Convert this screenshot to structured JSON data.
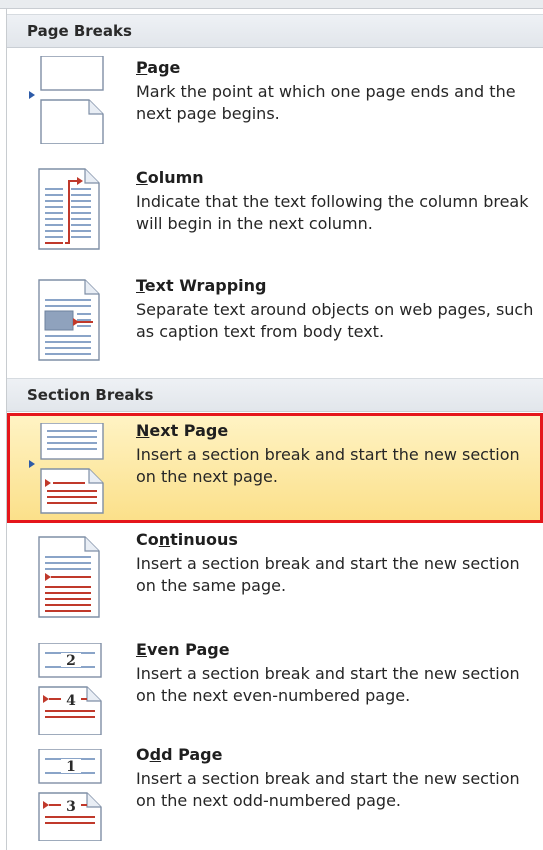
{
  "menu": {
    "page_breaks_header": "Page Breaks",
    "section_breaks_header": "Section Breaks",
    "items": [
      {
        "title_pre": "",
        "title_key": "P",
        "title_post": "age",
        "description": "Mark the point at which one page ends and the next page begins.",
        "icon": "page-break-icon"
      },
      {
        "title_pre": "",
        "title_key": "C",
        "title_post": "olumn",
        "description": "Indicate that the text following the column break will begin in the next column.",
        "icon": "column-break-icon"
      },
      {
        "title_pre": "",
        "title_key": "T",
        "title_post": "ext Wrapping",
        "description": "Separate text around objects on web pages, such as caption text from body text.",
        "icon": "text-wrapping-icon"
      },
      {
        "title_pre": "",
        "title_key": "N",
        "title_post": "ext Page",
        "description": "Insert a section break and start the new section on the next page.",
        "icon": "next-page-section-icon",
        "selected": true
      },
      {
        "title_pre": "Co",
        "title_key": "n",
        "title_post": "tinuous",
        "description": "Insert a section break and start the new section on the same page.",
        "icon": "continuous-section-icon"
      },
      {
        "title_pre": "",
        "title_key": "E",
        "title_post": "ven Page",
        "description": "Insert a section break and start the new section on the next even-numbered page.",
        "icon": "even-page-section-icon",
        "page_numbers": [
          "2",
          "4"
        ]
      },
      {
        "title_pre": "O",
        "title_key": "d",
        "title_post": "d Page",
        "description": "Insert a section break and start the new section on the next odd-numbered page.",
        "icon": "odd-page-section-icon",
        "page_numbers": [
          "1",
          "3"
        ]
      }
    ],
    "colors": {
      "highlight_top": "#fff3c4",
      "highlight_bottom": "#fbe08a",
      "selection_border": "#e5161b",
      "line_blue": "#8aa4c8",
      "line_red": "#c0392b"
    }
  }
}
